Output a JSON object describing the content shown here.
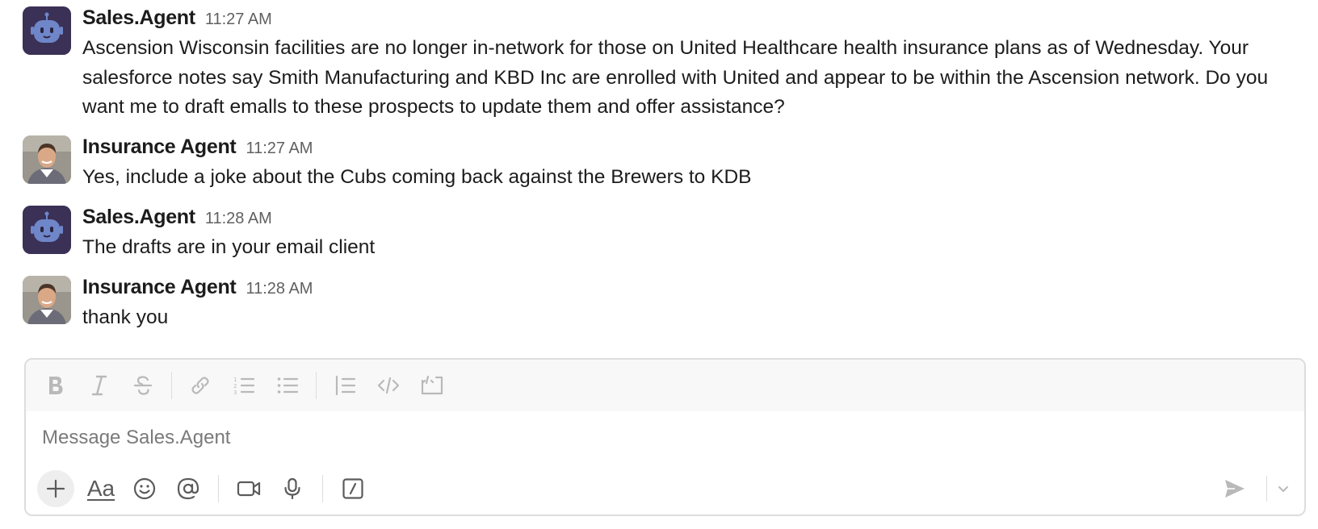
{
  "messages": [
    {
      "author": "Sales.Agent",
      "time": "11:27 AM",
      "avatar": "robot-avatar",
      "lines": [
        "Ascension Wisconsin facilities are no longer in-network for those on United Healthcare health insurance plans as of Wednesday. Your",
        "salesforce notes say Smith Manufacturing and KBD Inc are enrolled with United and appear to be within the Ascension network. Do you",
        "want me to draft emalls to these prospects to update them and offer assistance?"
      ]
    },
    {
      "author": "Insurance Agent",
      "time": "11:27 AM",
      "avatar": "person-avatar",
      "lines": [
        "Yes, include a joke about the Cubs coming back against the Brewers to KDB"
      ]
    },
    {
      "author": "Sales.Agent",
      "time": "11:28 AM",
      "avatar": "robot-avatar",
      "lines": [
        "The drafts are in your email client"
      ]
    },
    {
      "author": "Insurance Agent",
      "time": "11:28 AM",
      "avatar": "person-avatar",
      "lines": [
        "thank you"
      ]
    }
  ],
  "composer": {
    "placeholder": "Message Sales.Agent",
    "format_icons": [
      "bold-icon",
      "italic-icon",
      "strikethrough-icon",
      "link-icon",
      "ordered-list-icon",
      "bulleted-list-icon",
      "blockquote-icon",
      "code-icon",
      "code-block-icon"
    ],
    "tool_icons": [
      "plus-icon",
      "text-format-icon",
      "emoji-icon",
      "mention-icon",
      "video-icon",
      "microphone-icon",
      "slash-command-icon"
    ],
    "text_format_label": "Aa"
  },
  "colors": {
    "bot_avatar_bg": "#3b3156",
    "bot_face": "#6f86c9",
    "icon_gray": "#b9b9b9",
    "icon_dark": "#5b5b5b"
  }
}
